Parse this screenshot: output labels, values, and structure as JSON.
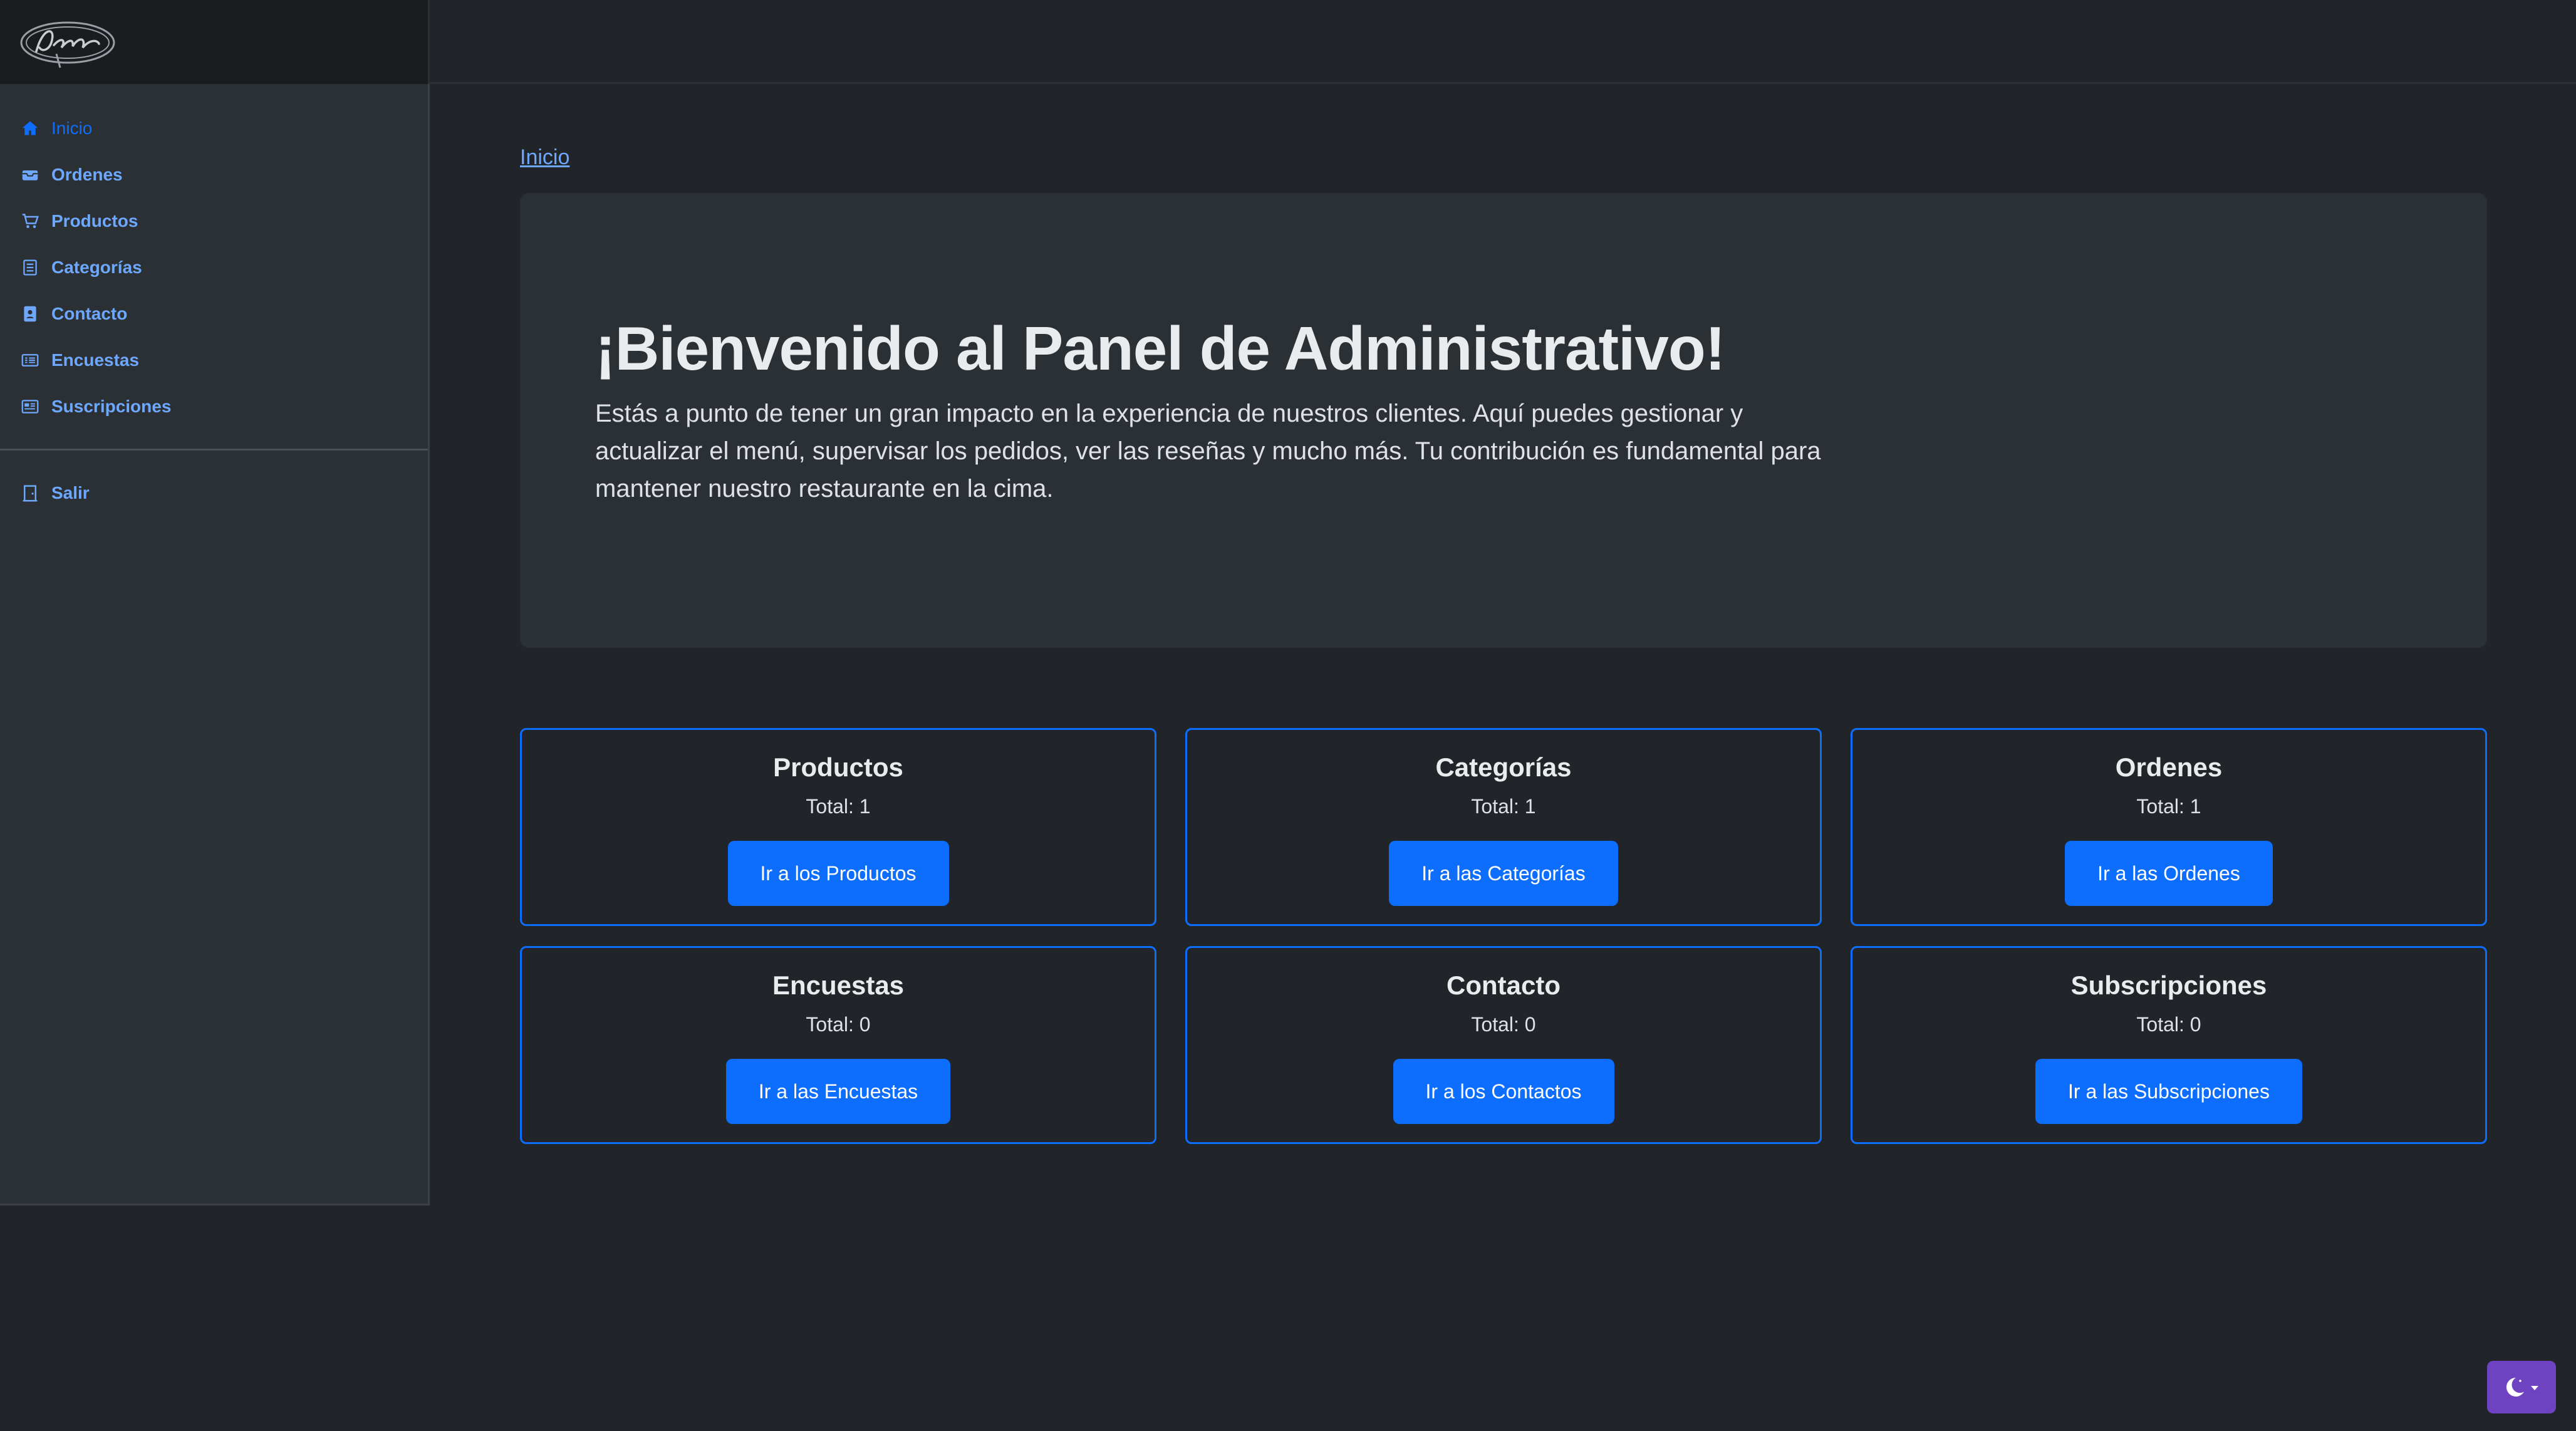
{
  "sidebar": {
    "items": [
      {
        "label": "Inicio",
        "icon": "home-icon"
      },
      {
        "label": "Ordenes",
        "icon": "inbox-icon"
      },
      {
        "label": "Productos",
        "icon": "cart-icon"
      },
      {
        "label": "Categorías",
        "icon": "list-icon"
      },
      {
        "label": "Contacto",
        "icon": "contact-book-icon"
      },
      {
        "label": "Encuestas",
        "icon": "survey-icon"
      },
      {
        "label": "Suscripciones",
        "icon": "newspaper-icon"
      }
    ],
    "logout": {
      "label": "Salir",
      "icon": "door-icon"
    }
  },
  "breadcrumb": "Inicio",
  "hero": {
    "title": "¡Bienvenido al Panel de Administrativo!",
    "text": "Estás a punto de tener un gran impacto en la experiencia de nuestros clientes. Aquí puedes gestionar y actualizar el menú, supervisar los pedidos, ver las reseñas y mucho más. Tu contribución es fundamental para mantener nuestro restaurante en la cima."
  },
  "cards": [
    {
      "title": "Productos",
      "total": "Total: 1",
      "button": "Ir a los Productos"
    },
    {
      "title": "Categorías",
      "total": "Total: 1",
      "button": "Ir a las Categorías"
    },
    {
      "title": "Ordenes",
      "total": "Total: 1",
      "button": "Ir a las Ordenes"
    },
    {
      "title": "Encuestas",
      "total": "Total: 0",
      "button": "Ir a las Encuestas"
    },
    {
      "title": "Contacto",
      "total": "Total: 0",
      "button": "Ir a los Contactos"
    },
    {
      "title": "Subscripciones",
      "total": "Total: 0",
      "button": "Ir a las Subscripciones"
    }
  ],
  "theme_toggle": {
    "icon": "moon-icon"
  },
  "colors": {
    "accent": "#0d6efd",
    "link": "#6ea8fe",
    "toggle": "#6f42c1",
    "background": "#212529",
    "panel": "#2b3035"
  }
}
